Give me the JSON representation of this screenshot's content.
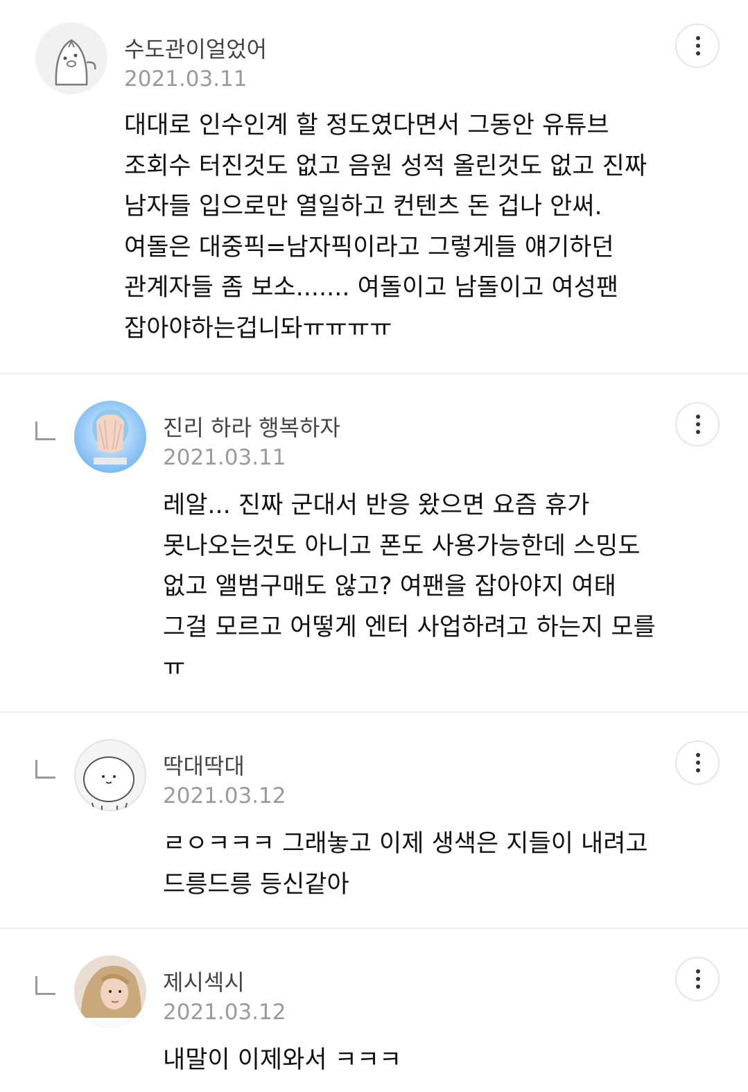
{
  "comments": [
    {
      "author": "수도관이얼었어",
      "date": "2021.03.11",
      "avatar_icon": "cartoon-ghost-avatar",
      "is_reply": false,
      "body": "대대로 인수인계 할 정도였다면서 그동안 유튜브\n조회수 터진것도 없고 음원 성적 올린것도 없고 진짜\n남자들 입으로만 열일하고 컨텐츠 돈 겁나 안써.\n여돌은 대중픽=남자픽이라고 그렇게들 얘기하던\n관계자들 좀 보소....... 여돌이고 남돌이고 여성팬\n잡아야하는겁니돠ㅠㅠㅠㅠ"
    },
    {
      "author": "진리 하라 행복하자",
      "date": "2021.03.11",
      "avatar_icon": "photo-avatar-hands",
      "is_reply": true,
      "body": "레알... 진짜 군대서 반응 왔으면 요즘 휴가\n못나오는것도 아니고 폰도 사용가능한데 스밍도\n없고 앨범구매도 않고? 여팬을 잡아야지 여태\n그걸 모르고 어떻게 엔터 사업하려고 하는지 모를\nㅠ"
    },
    {
      "author": "딱대딱대",
      "date": "2021.03.12",
      "avatar_icon": "cartoon-blob-avatar",
      "is_reply": true,
      "body": "ㄹㅇㅋㅋㅋ 그래놓고 이제 생색은 지들이 내려고\n드릉드릉 등신같아"
    },
    {
      "author": "제시섹시",
      "date": "2021.03.12",
      "avatar_icon": "photo-avatar-blonde",
      "is_reply": true,
      "body": "내말이 이제와서 ㅋㅋㅋ"
    }
  ],
  "colors": {
    "divider": "#ececec",
    "author": "#444444",
    "date": "#9a9a9a",
    "body": "#111111"
  }
}
